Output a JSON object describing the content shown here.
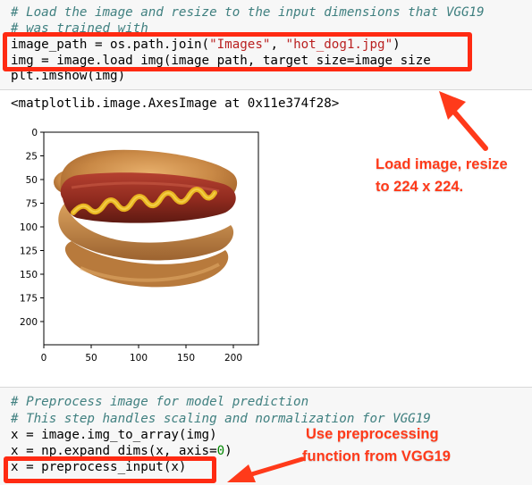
{
  "top_cell": {
    "lines": [
      {
        "kind": "comment",
        "text": "# Load the image and resize to the input dimensions that VGG19"
      },
      {
        "kind": "comment",
        "text": "# was trained with"
      },
      {
        "kind": "code",
        "parts": [
          "image_path = os.path.join(",
          "\"Images\"",
          ", ",
          "\"hot_dog1.jpg\"",
          ")"
        ]
      },
      {
        "kind": "code",
        "parts": [
          "img = image.load_img(image_path, target_size=image_size"
        ]
      },
      {
        "kind": "code",
        "parts": [
          "plt.imshow(img)"
        ]
      }
    ]
  },
  "output": {
    "repr_text": "<matplotlib.image.AxesImage at 0x11e374f28>"
  },
  "plot": {
    "y_ticks": [
      "0",
      "25",
      "50",
      "75",
      "100",
      "125",
      "150",
      "175",
      "200"
    ],
    "x_ticks": [
      "0",
      "50",
      "100",
      "150",
      "200"
    ],
    "image_subject": "hot dog with mustard"
  },
  "annotations": {
    "resize_note": [
      "Load image, resize",
      "to 224 x 224."
    ],
    "preprocess_note": [
      "Use preprocessing",
      "function from VGG19"
    ]
  },
  "bottom_cell": {
    "comment1": "# Preprocess image for model prediction",
    "comment2": "# This step handles scaling and normalization for VGG19",
    "line3": "x = image.img_to_array(img)",
    "line4_a": "x = np.expand_dims(x, axis=",
    "line4_num": "0",
    "line4_b": ")",
    "line5": "x = preprocess_input(x)"
  },
  "colors": {
    "highlight_red": "#ff2a12",
    "annotation_red": "#ff3a1a",
    "comment_teal": "#408080",
    "string_red": "#ba2121"
  }
}
